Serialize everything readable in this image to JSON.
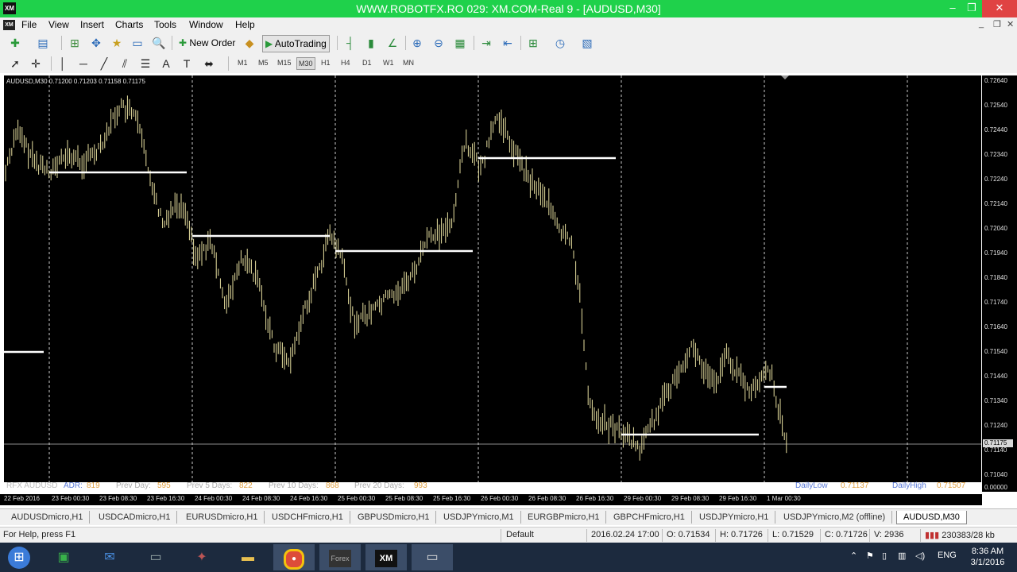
{
  "window": {
    "title": "WWW.ROBOTFX.RO 029: XM.COM-Real 9 - [AUDUSD,M30]",
    "logo": "XM"
  },
  "menu": [
    "File",
    "View",
    "Insert",
    "Charts",
    "Tools",
    "Window",
    "Help"
  ],
  "toolbar": {
    "new_order": "New Order",
    "auto_trading": "AutoTrading"
  },
  "timeframes": [
    "M1",
    "M5",
    "M15",
    "M30",
    "H1",
    "H4",
    "D1",
    "W1",
    "MN"
  ],
  "selected_timeframe": "M30",
  "chart": {
    "ohlc": "AUDUSD,M30  0.71200 0.71203 0.71158 0.71175",
    "price_labels": [
      "0.72640",
      "0.72540",
      "0.72440",
      "0.72340",
      "0.72240",
      "0.72140",
      "0.72040",
      "0.71940",
      "0.71840",
      "0.71740",
      "0.71640",
      "0.71540",
      "0.71440",
      "0.71340",
      "0.71240",
      "0.71140",
      "0.71040"
    ],
    "current_price": "0.71175",
    "bottom_price": "0.00000",
    "time_labels": [
      "22 Feb 2016",
      "23 Feb 00:30",
      "23 Feb 08:30",
      "23 Feb 16:30",
      "24 Feb 00:30",
      "24 Feb 08:30",
      "24 Feb 16:30",
      "25 Feb 00:30",
      "25 Feb 08:30",
      "25 Feb 16:30",
      "26 Feb 00:30",
      "26 Feb 08:30",
      "26 Feb 16:30",
      "29 Feb 00:30",
      "29 Feb 08:30",
      "29 Feb 16:30",
      "1 Mar 00:30"
    ],
    "stats": {
      "source": "RFX AUDUSD",
      "adr_label": "ADR:",
      "adr": "819",
      "prev_day_label": "Prev Day:",
      "prev_day": "595",
      "prev5_label": "Prev 5 Days:",
      "prev5": "822",
      "prev10_label": "Prev 10 Days:",
      "prev10": "868",
      "prev20_label": "Prev 20 Days:",
      "prev20": "993",
      "daily_low_label": "DailyLow",
      "daily_low": "0.71137",
      "daily_high_label": "DailyHigh",
      "daily_high": "0.71507"
    },
    "colors": {
      "bars": "#e8e0a0",
      "levels": "#ffffff",
      "background": "#000000"
    }
  },
  "tabs": [
    "AUDUSDmicro,H1",
    "USDCADmicro,H1",
    "EURUSDmicro,H1",
    "USDCHFmicro,H1",
    "GBPUSDmicro,H1",
    "USDJPYmicro,M1",
    "EURGBPmicro,H1",
    "GBPCHFmicro,H1",
    "USDJPYmicro,H1",
    "USDJPYmicro,M2 (offline)",
    "AUDUSD,M30"
  ],
  "active_tab": "AUDUSD,M30",
  "status": {
    "help": "For Help, press F1",
    "profile": "Default",
    "datetime": "2016.02.24 17:00",
    "open": "O: 0.71534",
    "high": "H: 0.71726",
    "low": "L: 0.71529",
    "close": "C: 0.71726",
    "volume": "V: 2936",
    "traffic": "230383/28 kb"
  },
  "taskbar": {
    "language": "ENG",
    "time": "8:36 AM",
    "date": "3/1/2016",
    "apps": [
      "start-orb",
      "store",
      "mail",
      "monitor",
      "app",
      "explorer",
      "chrome",
      "forex",
      "xm",
      "window"
    ]
  }
}
